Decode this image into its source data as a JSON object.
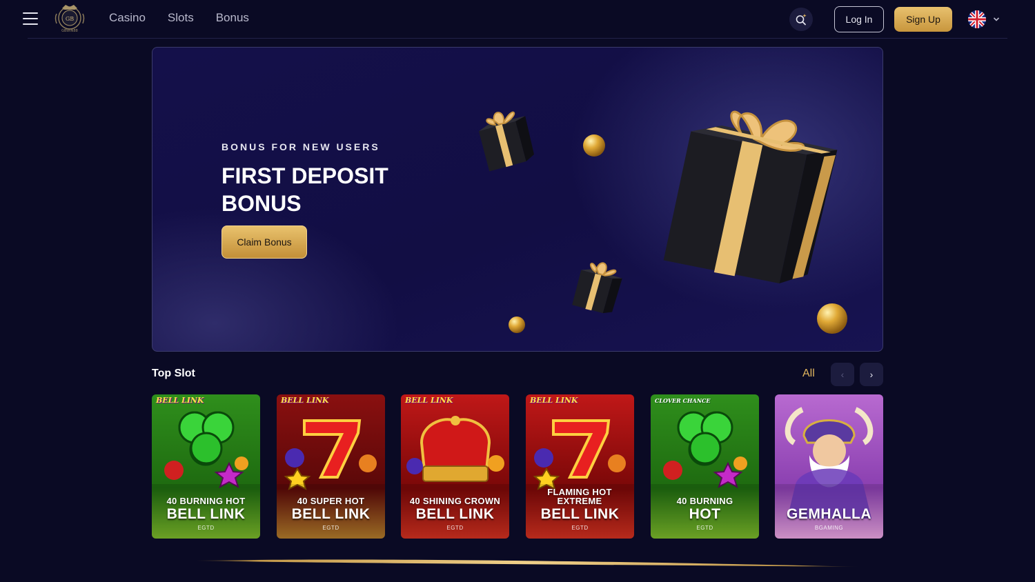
{
  "header": {
    "brand": "GBWIN88",
    "nav": [
      "Casino",
      "Slots",
      "Bonus"
    ],
    "login_label": "Log In",
    "signup_label": "Sign Up",
    "language_icon": "uk-flag-icon"
  },
  "banner": {
    "subtitle": "BONUS FOR NEW USERS",
    "title": "FIRST DEPOSIT BONUS",
    "cta_label": "Claim Bonus"
  },
  "top_slot": {
    "title": "Top Slot",
    "all_label": "All",
    "prev_label": "‹",
    "next_label": "›",
    "games": [
      {
        "badge": "BELL LINK",
        "line1": "40 BURNING HOT",
        "line2": "BELL LINK",
        "maker": "EGTD",
        "bg": "green",
        "art": "clover"
      },
      {
        "badge": "BELL LINK",
        "line1": "40 SUPER HOT",
        "line2": "BELL LINK",
        "maker": "EGTD",
        "bg": "darkred",
        "art": "seven"
      },
      {
        "badge": "BELL LINK",
        "line1": "40 SHINING CROWN",
        "line2": "BELL LINK",
        "maker": "EGTD",
        "bg": "red",
        "art": "crown"
      },
      {
        "badge": "BELL LINK",
        "line1": "FLAMING HOT EXTREME",
        "line2": "BELL LINK",
        "maker": "EGTD",
        "bg": "red",
        "art": "seven"
      },
      {
        "badge": "CLOVER CHANCE",
        "line1": "40 BURNING",
        "line2": "HOT",
        "maker": "EGTD",
        "bg": "green",
        "art": "clover"
      },
      {
        "badge": "",
        "line1": "",
        "line2": "GEMHALLA",
        "maker": "BGAMING",
        "bg": "purple",
        "art": "viking"
      }
    ]
  },
  "colors": {
    "background": "#0a0a24",
    "gold": "#e0b55e",
    "banner": "#14104a"
  }
}
